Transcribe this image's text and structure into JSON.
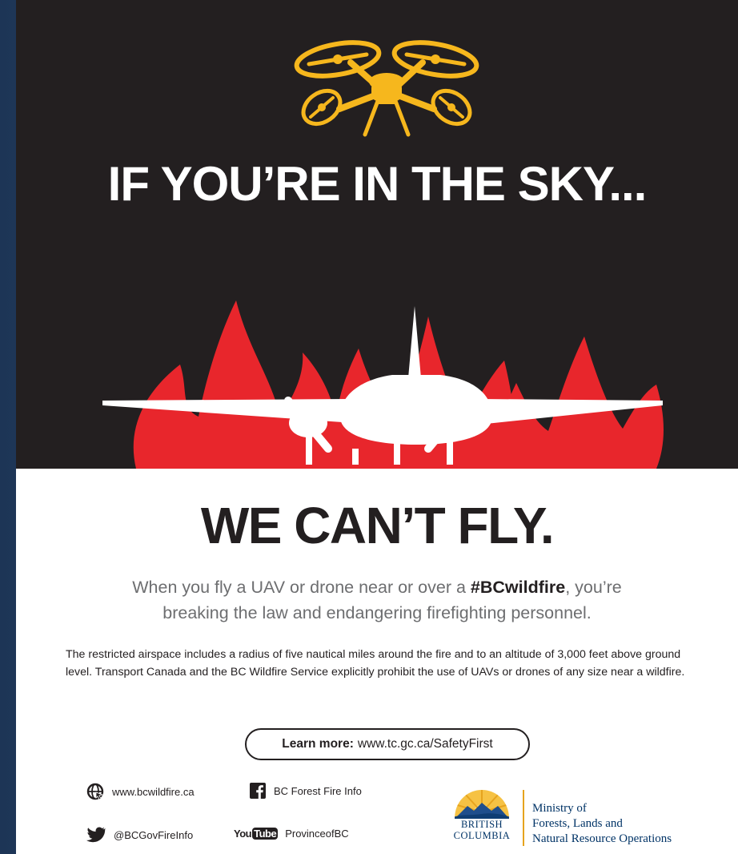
{
  "poster": {
    "headline_top": "IF YOU’RE IN THE SKY...",
    "headline_bottom": "WE CAN’T FLY.",
    "subhead": {
      "line1_start": "When you fly a UAV or drone near or over a ",
      "hashtag": "#BCwildfire",
      "line1_end": ", you’re",
      "line2": "breaking the law and endangering firefighting personnel."
    },
    "body": "The restricted airspace includes a radius of five nautical miles around the fire and to an altitude of 3,000 feet above ground level. Transport Canada and the BC Wildfire Service explicitly prohibit the use of UAVs or drones of any size near a wildfire.",
    "learn_more": {
      "label": "Learn more:",
      "url": "www.tc.gc.ca/SafetyFirst"
    }
  },
  "footer": {
    "website": "www.bcwildfire.ca",
    "twitter": "@BCGovFireInfo",
    "facebook": "BC Forest Fire Info",
    "youtube": "ProvinceofBC",
    "youtube_logo": {
      "you": "You",
      "tube": "Tube"
    },
    "bc_wordmark": {
      "line1": "BRITISH",
      "line2": "COLUMBIA"
    },
    "ministry": {
      "line1": "Ministry of",
      "line2": "Forests, Lands and",
      "line3": "Natural Resource Operations"
    }
  },
  "icons": [
    "drone-icon",
    "flames-icon",
    "airplane-icon",
    "globe-icon",
    "twitter-icon",
    "facebook-icon",
    "youtube-icon",
    "bc-logo-icon"
  ],
  "colors": {
    "dark_panel": "#231f20",
    "drone_yellow": "#f6b71d",
    "flame_red": "#e8262c",
    "text_gray": "#6d6e70",
    "bc_blue": "#003366",
    "bc_gold": "#e6a31e",
    "backdrop_blue": "#223a5c"
  }
}
